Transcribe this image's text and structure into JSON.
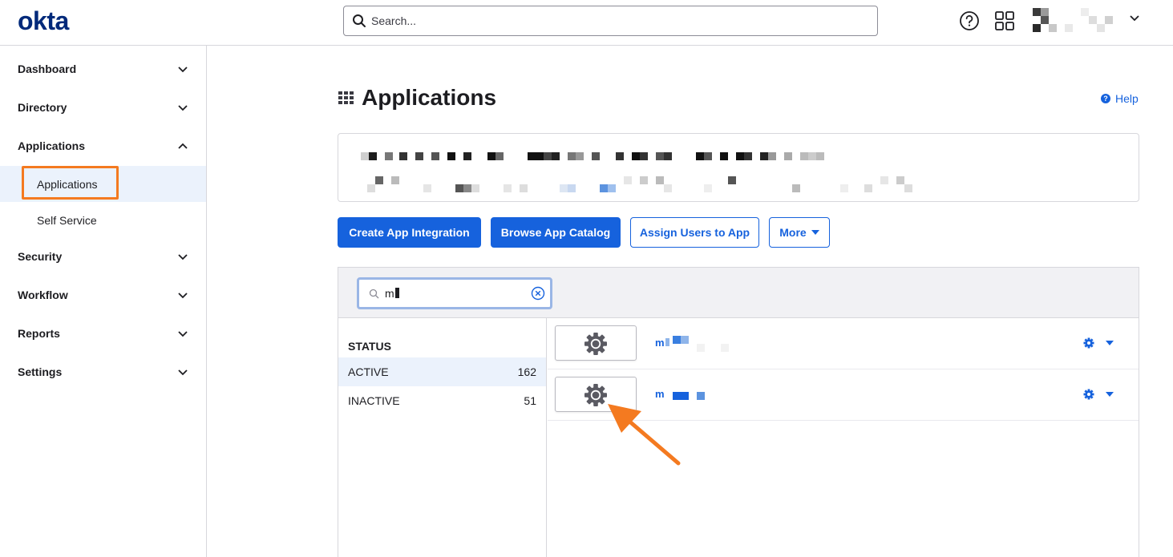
{
  "topbar": {
    "logo": "okta",
    "search_placeholder": "Search...",
    "icons": [
      "help-circle-icon",
      "app-grid-icon",
      "chevron-down-icon"
    ]
  },
  "sidebar": {
    "items": [
      {
        "label": "Dashboard",
        "expanded": false
      },
      {
        "label": "Directory",
        "expanded": false
      },
      {
        "label": "Applications",
        "expanded": true,
        "children": [
          {
            "label": "Applications",
            "active": true
          },
          {
            "label": "Self Service",
            "active": false
          }
        ]
      },
      {
        "label": "Security",
        "expanded": false
      },
      {
        "label": "Workflow",
        "expanded": false
      },
      {
        "label": "Reports",
        "expanded": false
      },
      {
        "label": "Settings",
        "expanded": false
      }
    ]
  },
  "main": {
    "title": "Applications",
    "help_label": "Help",
    "buttons": {
      "create": "Create App Integration",
      "browse": "Browse App Catalog",
      "assign": "Assign Users to App",
      "more": "More"
    },
    "filter": {
      "value": "m"
    },
    "status": {
      "header": "STATUS",
      "rows": [
        {
          "name": "ACTIVE",
          "count": "162"
        },
        {
          "name": "INACTIVE",
          "count": "51"
        }
      ]
    },
    "apps": [
      {
        "name": "m",
        "icon": "gear-icon"
      },
      {
        "name": "m",
        "icon": "gear-icon"
      }
    ]
  },
  "colors": {
    "brand": "#00297a",
    "primary": "#1662dd",
    "annotation": "#f47a20",
    "selected_bg": "#ebf2fc"
  }
}
